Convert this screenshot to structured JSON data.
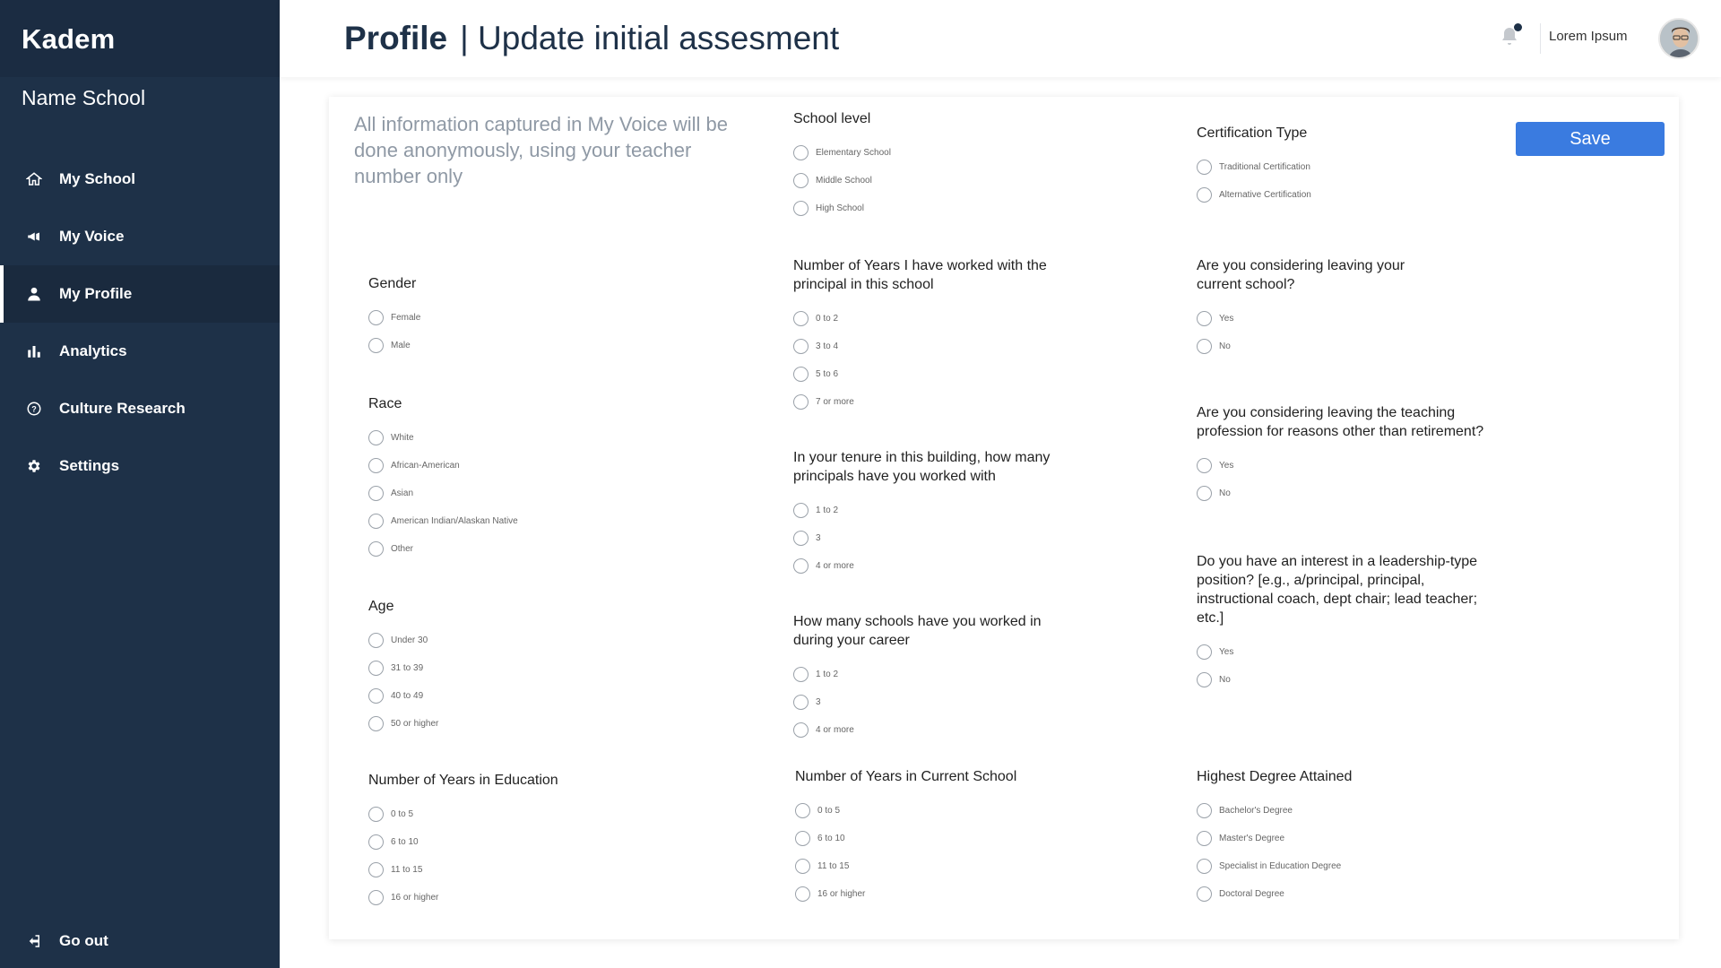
{
  "app": {
    "brand": "Kadem",
    "school_name": "Name School"
  },
  "nav": [
    {
      "label": "My School",
      "icon": "home-icon"
    },
    {
      "label": "My Voice",
      "icon": "megaphone-icon"
    },
    {
      "label": "My Profile",
      "icon": "user-icon",
      "active": true
    },
    {
      "label": "Analytics",
      "icon": "bar-chart-icon"
    },
    {
      "label": "Culture Research",
      "icon": "question-circle-icon"
    },
    {
      "label": "Settings",
      "icon": "gear-icon"
    }
  ],
  "go_out": {
    "label": "Go out",
    "icon": "logout-icon"
  },
  "header": {
    "title": "Profile",
    "subtitle": "| Update initial assesment",
    "user_name": "Lorem Ipsum"
  },
  "form": {
    "intro": "All information captured in My Voice will be done anonymously, using your teacher number only",
    "save_label": "Save",
    "questions": {
      "school_level": {
        "title": "School level",
        "options": [
          "Elementary School",
          "Middle School",
          "High School"
        ]
      },
      "certification": {
        "title": "Certification Type",
        "options": [
          "Traditional Certification",
          "Alternative Certification"
        ]
      },
      "gender": {
        "title": "Gender",
        "options": [
          "Female",
          "Male"
        ]
      },
      "years_principal": {
        "title": "Number of Years I have worked with the principal in this school",
        "options": [
          "0 to 2",
          "3 to 4",
          "5 to 6",
          "7 or more"
        ]
      },
      "leaving_school": {
        "title": "Are you considering leaving your current school?",
        "options": [
          "Yes",
          "No"
        ]
      },
      "race": {
        "title": "Race",
        "options": [
          "White",
          "African-American",
          "Asian",
          "American Indian/Alaskan Native",
          "Other"
        ]
      },
      "principals_count": {
        "title": "In your tenure in this building, how many principals have you worked with",
        "options": [
          "1 to 2",
          "3",
          "4 or more"
        ]
      },
      "leaving_profession": {
        "title": "Are you considering leaving the teaching profession for reasons other than retirement?",
        "options": [
          "Yes",
          "No"
        ]
      },
      "age": {
        "title": "Age",
        "options": [
          "Under 30",
          "31 to 39",
          "40 to 49",
          "50 or higher"
        ]
      },
      "schools_worked": {
        "title": "How many schools have you worked in during your career",
        "options": [
          "1 to 2",
          "3",
          "4 or more"
        ]
      },
      "leadership": {
        "title": "Do you have an interest in a leadership-type position? [e.g., a/principal, principal, instructional coach, dept chair; lead teacher; etc.]",
        "options": [
          "Yes",
          "No"
        ]
      },
      "years_education": {
        "title": "Number of Years in Education",
        "options": [
          "0 to 5",
          "6 to 10",
          "11 to 15",
          "16 or higher"
        ]
      },
      "years_current": {
        "title": "Number of Years in Current School",
        "options": [
          "0 to 5",
          "6 to 10",
          "11 to 15",
          "16 or higher"
        ]
      },
      "degree": {
        "title": "Highest Degree Attained",
        "options": [
          "Bachelor's Degree",
          "Master's Degree",
          "Specialist in Education Degree",
          "Doctoral Degree"
        ]
      }
    }
  }
}
